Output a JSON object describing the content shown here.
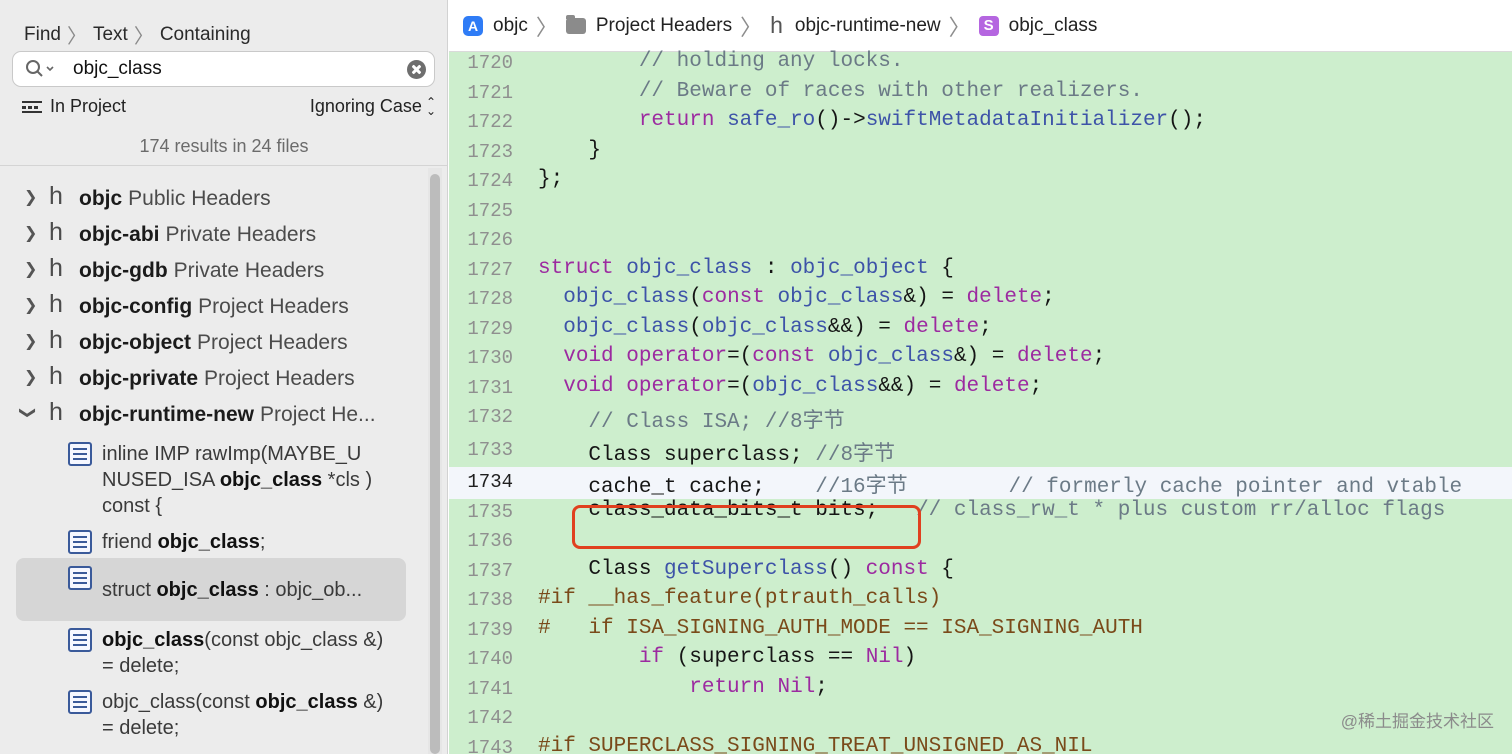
{
  "navigator": {
    "breadcrumb": [
      "Find",
      "Text",
      "Containing"
    ],
    "search": {
      "value": "objc_class",
      "placeholder": ""
    },
    "scope": {
      "label": "In Project",
      "mode": "Ignoring Case"
    },
    "summary": "174 results in 24 files",
    "files": [
      {
        "name": "objc",
        "group": "Public Headers",
        "expanded": false
      },
      {
        "name": "objc-abi",
        "group": "Private Headers",
        "expanded": false
      },
      {
        "name": "objc-gdb",
        "group": "Private Headers",
        "expanded": false
      },
      {
        "name": "objc-config",
        "group": "Project Headers",
        "expanded": false
      },
      {
        "name": "objc-object",
        "group": "Project Headers",
        "expanded": false
      },
      {
        "name": "objc-private",
        "group": "Project Headers",
        "expanded": false
      },
      {
        "name": "objc-runtime-new",
        "group": "Project He...",
        "expanded": true
      }
    ],
    "matches": [
      {
        "pre": "inline IMP rawImp(MAYBE_U NUSED_ISA ",
        "hit": "objc_class",
        "post": " *cls ) const {"
      },
      {
        "pre": "friend ",
        "hit": "objc_class",
        "post": ";"
      },
      {
        "pre": "struct ",
        "hit": "objc_class",
        "post": " : objc_ob..."
      },
      {
        "pre": "",
        "hit": "objc_class",
        "post": "(const objc_class &) = delete;"
      },
      {
        "pre": "objc_class(const ",
        "hit": "objc_class",
        "post": " &) = delete;"
      }
    ]
  },
  "jumpbar": {
    "project": "objc",
    "group": "Project Headers",
    "file": "objc-runtime-new",
    "symbol": "objc_class",
    "file_icon_letter": "h",
    "symbol_icon_letter": "S"
  },
  "editor": {
    "current_line": "1734",
    "lines": [
      {
        "n": "1720",
        "t": "        // holding any locks."
      },
      {
        "n": "1721",
        "t": "        // Beware of races with other realizers."
      },
      {
        "n": "1722",
        "t": "        return safe_ro()->swiftMetadataInitializer();"
      },
      {
        "n": "1723",
        "t": "    }"
      },
      {
        "n": "1724",
        "t": "};"
      },
      {
        "n": "1725",
        "t": ""
      },
      {
        "n": "1726",
        "t": ""
      },
      {
        "n": "1727",
        "t": "struct objc_class : objc_object {"
      },
      {
        "n": "1728",
        "t": "  objc_class(const objc_class&) = delete;"
      },
      {
        "n": "1729",
        "t": "  objc_class(objc_class&&) = delete;"
      },
      {
        "n": "1730",
        "t": "  void operator=(const objc_class&) = delete;"
      },
      {
        "n": "1731",
        "t": "  void operator=(objc_class&&) = delete;"
      },
      {
        "n": "1732",
        "t": "    // Class ISA; //8字节"
      },
      {
        "n": "1733",
        "t": "    Class superclass; //8字节"
      },
      {
        "n": "1734",
        "t": "    cache_t cache;    //16字节        // formerly cache pointer and vtable"
      },
      {
        "n": "1735",
        "t": "    class_data_bits_t bits;   // class_rw_t * plus custom rr/alloc flags"
      },
      {
        "n": "1736",
        "t": ""
      },
      {
        "n": "1737",
        "t": "    Class getSuperclass() const {"
      },
      {
        "n": "1738",
        "t": "#if __has_feature(ptrauth_calls)"
      },
      {
        "n": "1739",
        "t": "#   if ISA_SIGNING_AUTH_MODE == ISA_SIGNING_AUTH"
      },
      {
        "n": "1740",
        "t": "        if (superclass == Nil)"
      },
      {
        "n": "1741",
        "t": "            return Nil;"
      },
      {
        "n": "1742",
        "t": ""
      },
      {
        "n": "1743",
        "t": "#if SUPERCLASS_SIGNING_TREAT_UNSIGNED_AS_NIL"
      }
    ]
  },
  "watermark": "@稀土掘金技术社区",
  "colors": {
    "editor_bg": "#cdeecd",
    "highlight_box": "#e0401f",
    "keyword": "#9c2aa0",
    "comment": "#6b7a86"
  }
}
